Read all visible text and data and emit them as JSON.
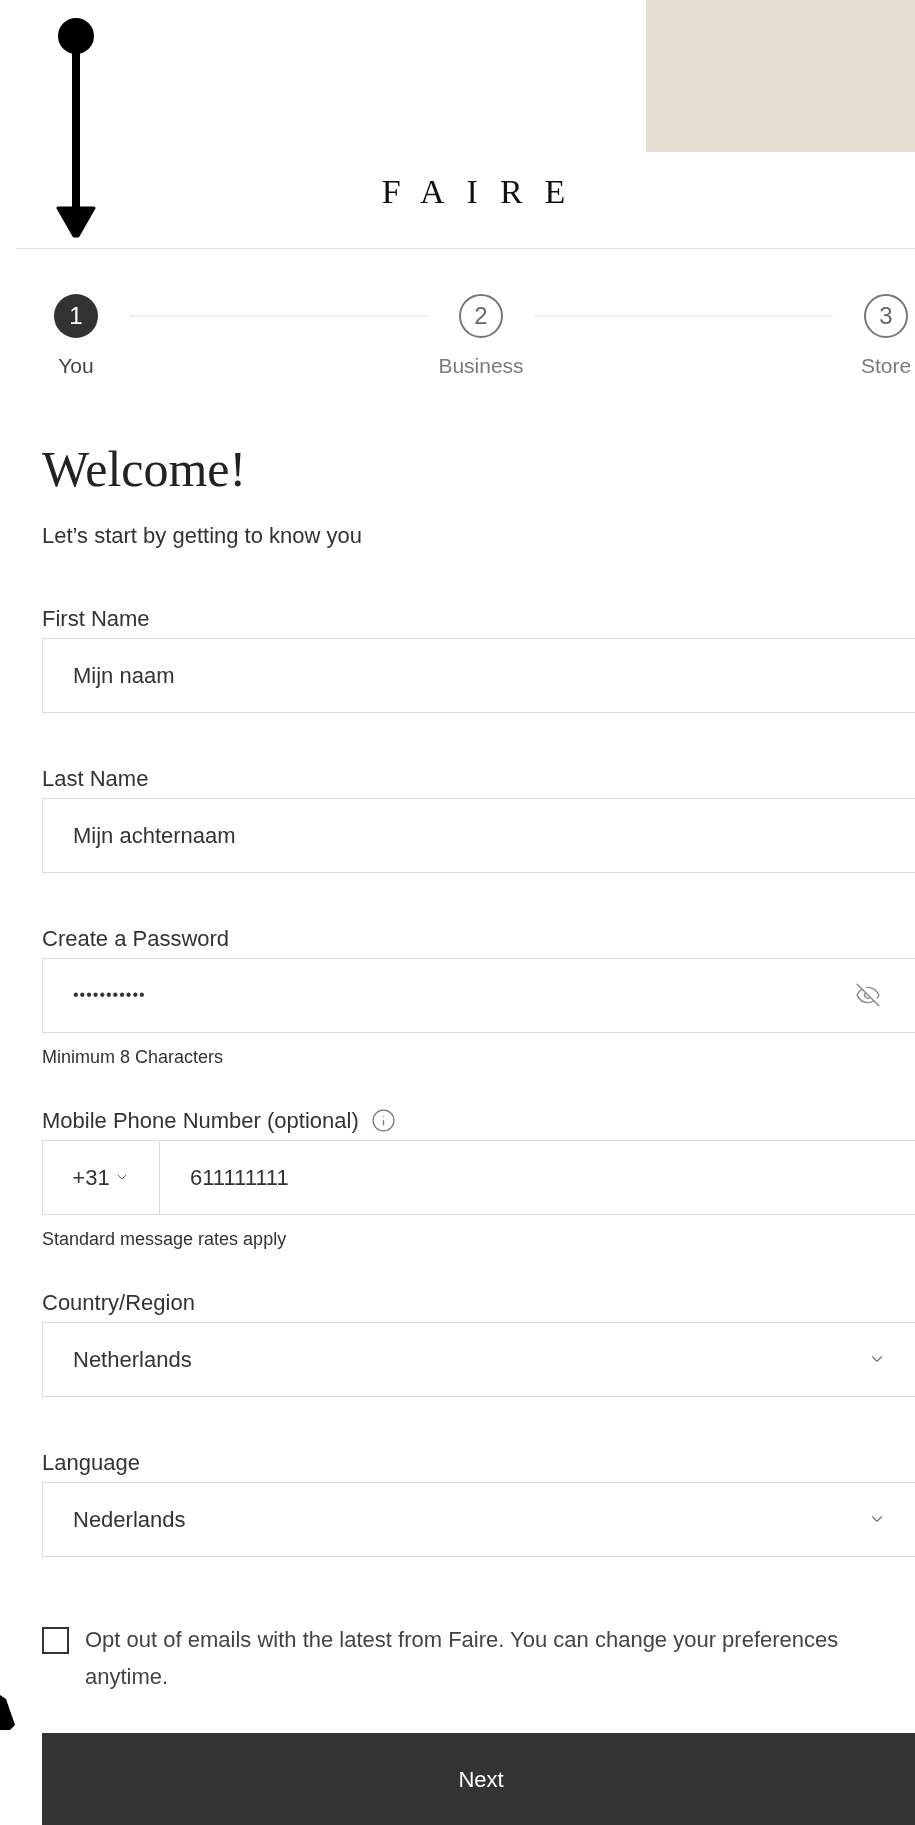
{
  "logo": "FAIRE",
  "steps": [
    {
      "number": "1",
      "label": "You",
      "selected": true
    },
    {
      "number": "2",
      "label": "Business",
      "selected": false
    },
    {
      "number": "3",
      "label": "Store",
      "selected": false
    }
  ],
  "heading": "Welcome!",
  "subheading": "Let’s start by getting to know you",
  "fields": [
    {
      "kind": "text",
      "label": "First Name",
      "value": "Mijn naam"
    },
    {
      "kind": "text",
      "label": "Last Name",
      "value": "Mijn achternaam"
    },
    {
      "kind": "password",
      "label": "Create a Password",
      "value": "•••••••••••",
      "hint": "Minimum 8 Characters"
    },
    {
      "kind": "phone",
      "label": "Mobile Phone Number (optional)",
      "code": "+31",
      "value": "611111111",
      "hint": "Standard message rates apply"
    },
    {
      "kind": "select",
      "label": "Country/Region",
      "value": "Netherlands"
    },
    {
      "kind": "select",
      "label": "Language",
      "value": "Nederlands"
    }
  ],
  "opt_out": {
    "label": "Opt out of emails with the latest from Faire. You can change your preferences anytime.",
    "checked": false
  },
  "button": "Next"
}
